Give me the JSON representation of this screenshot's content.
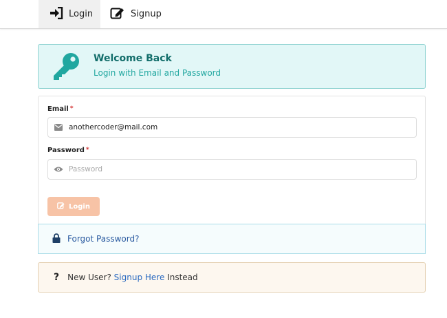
{
  "nav": {
    "login_label": "Login",
    "signup_label": "Signup"
  },
  "welcome": {
    "title": "Welcome Back",
    "subtitle": "Login with Email and Password"
  },
  "form": {
    "email_label": "Email",
    "email_value": "anothercoder@mail.com",
    "password_label": "Password",
    "password_placeholder": "Password",
    "required_mark": "*",
    "login_button": "Login"
  },
  "forgot": {
    "label": "Forgot Password?"
  },
  "new_user": {
    "prefix": "New User?",
    "link": "Signup Here",
    "suffix": "Instead",
    "icon_glyph": "?"
  },
  "colors": {
    "teal_dark": "#136e6b",
    "teal": "#21a7a0",
    "orange_button": "#f7c3a6",
    "link_blue": "#2a5aa0"
  },
  "icons": [
    "sign-in-icon",
    "edit-icon",
    "key-icon",
    "envelope-icon",
    "eye-icon",
    "lock-icon",
    "question-icon"
  ]
}
